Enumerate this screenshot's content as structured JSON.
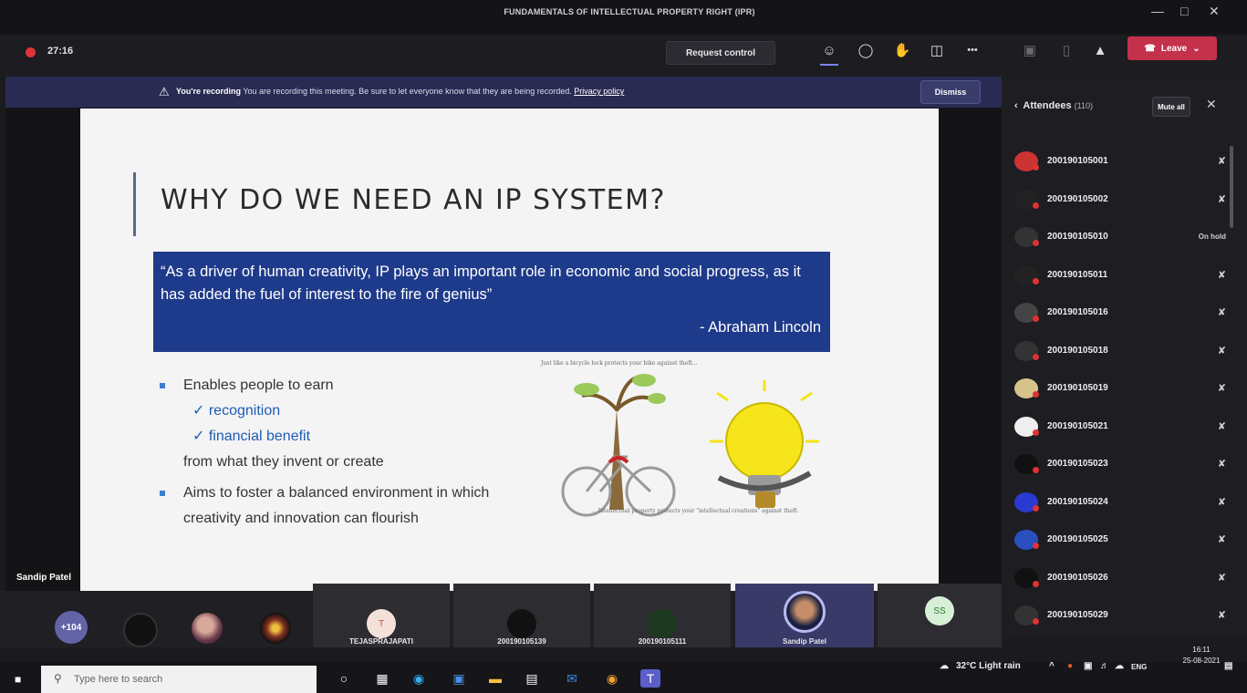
{
  "window": {
    "title": "FUNDAMENTALS OF INTELLECTUAL PROPERTY RIGHT (IPR)"
  },
  "toolbar": {
    "timer": "27:16",
    "request_control": "Request control",
    "more": "•••",
    "leave": "Leave"
  },
  "banner": {
    "bold": "You're recording",
    "message": "You are recording this meeting. Be sure to let everyone know that they are being recorded.",
    "link": "Privacy policy",
    "dismiss": "Dismiss"
  },
  "slide": {
    "title": "WHY DO WE NEED AN IP SYSTEM?",
    "quote": "“As a driver of human creativity, IP plays an important role in economic and social progress, as it has added the fuel of interest to the fire of genius”",
    "author": "- Abraham Lincoln",
    "bullet1": "Enables people to earn",
    "check1": "✓ recognition",
    "check2": "✓ financial benefit",
    "bullet1_tail": "from what they invent or create",
    "bullet2": "Aims to foster a balanced environment in which creativity and innovation can flourish",
    "caption_top": "Just like a bicycle lock protects your bike against theft...",
    "caption_bottom": "... Intellectual property protects your \"intellectual creations\" against theft."
  },
  "presenter": {
    "name": "Sandip Patel"
  },
  "attendees": {
    "title": "Attendees",
    "count": "(110)",
    "mute_all": "Mute all",
    "list": [
      {
        "name": "200190105001",
        "status": "✘"
      },
      {
        "name": "200190105002",
        "status": "✘"
      },
      {
        "name": "200190105010",
        "status": "On hold"
      },
      {
        "name": "200190105011",
        "status": "✘"
      },
      {
        "name": "200190105016",
        "status": "✘"
      },
      {
        "name": "200190105018",
        "status": "✘"
      },
      {
        "name": "200190105019",
        "status": "✘"
      },
      {
        "name": "200190105021",
        "status": "✘"
      },
      {
        "name": "200190105023",
        "status": "✘"
      },
      {
        "name": "200190105024",
        "status": "✘"
      },
      {
        "name": "200190105025",
        "status": "✘"
      },
      {
        "name": "200190105026",
        "status": "✘"
      },
      {
        "name": "200190105029",
        "status": "✘"
      }
    ]
  },
  "gallery": {
    "more_count": "+104",
    "tiles": [
      {
        "name": "TEJASPRAJAPATI",
        "initial": "T"
      },
      {
        "name": "200190105139",
        "initial": ""
      },
      {
        "name": "200190105111",
        "initial": ""
      },
      {
        "name": "Sandip Patel",
        "initial": ""
      },
      {
        "name": "",
        "initial": "SS"
      }
    ]
  },
  "taskbar": {
    "search_placeholder": "Type here to search",
    "weather": "32°C  Light rain",
    "lang": "ENG",
    "time": "16:11",
    "date": "25-08-2021"
  }
}
